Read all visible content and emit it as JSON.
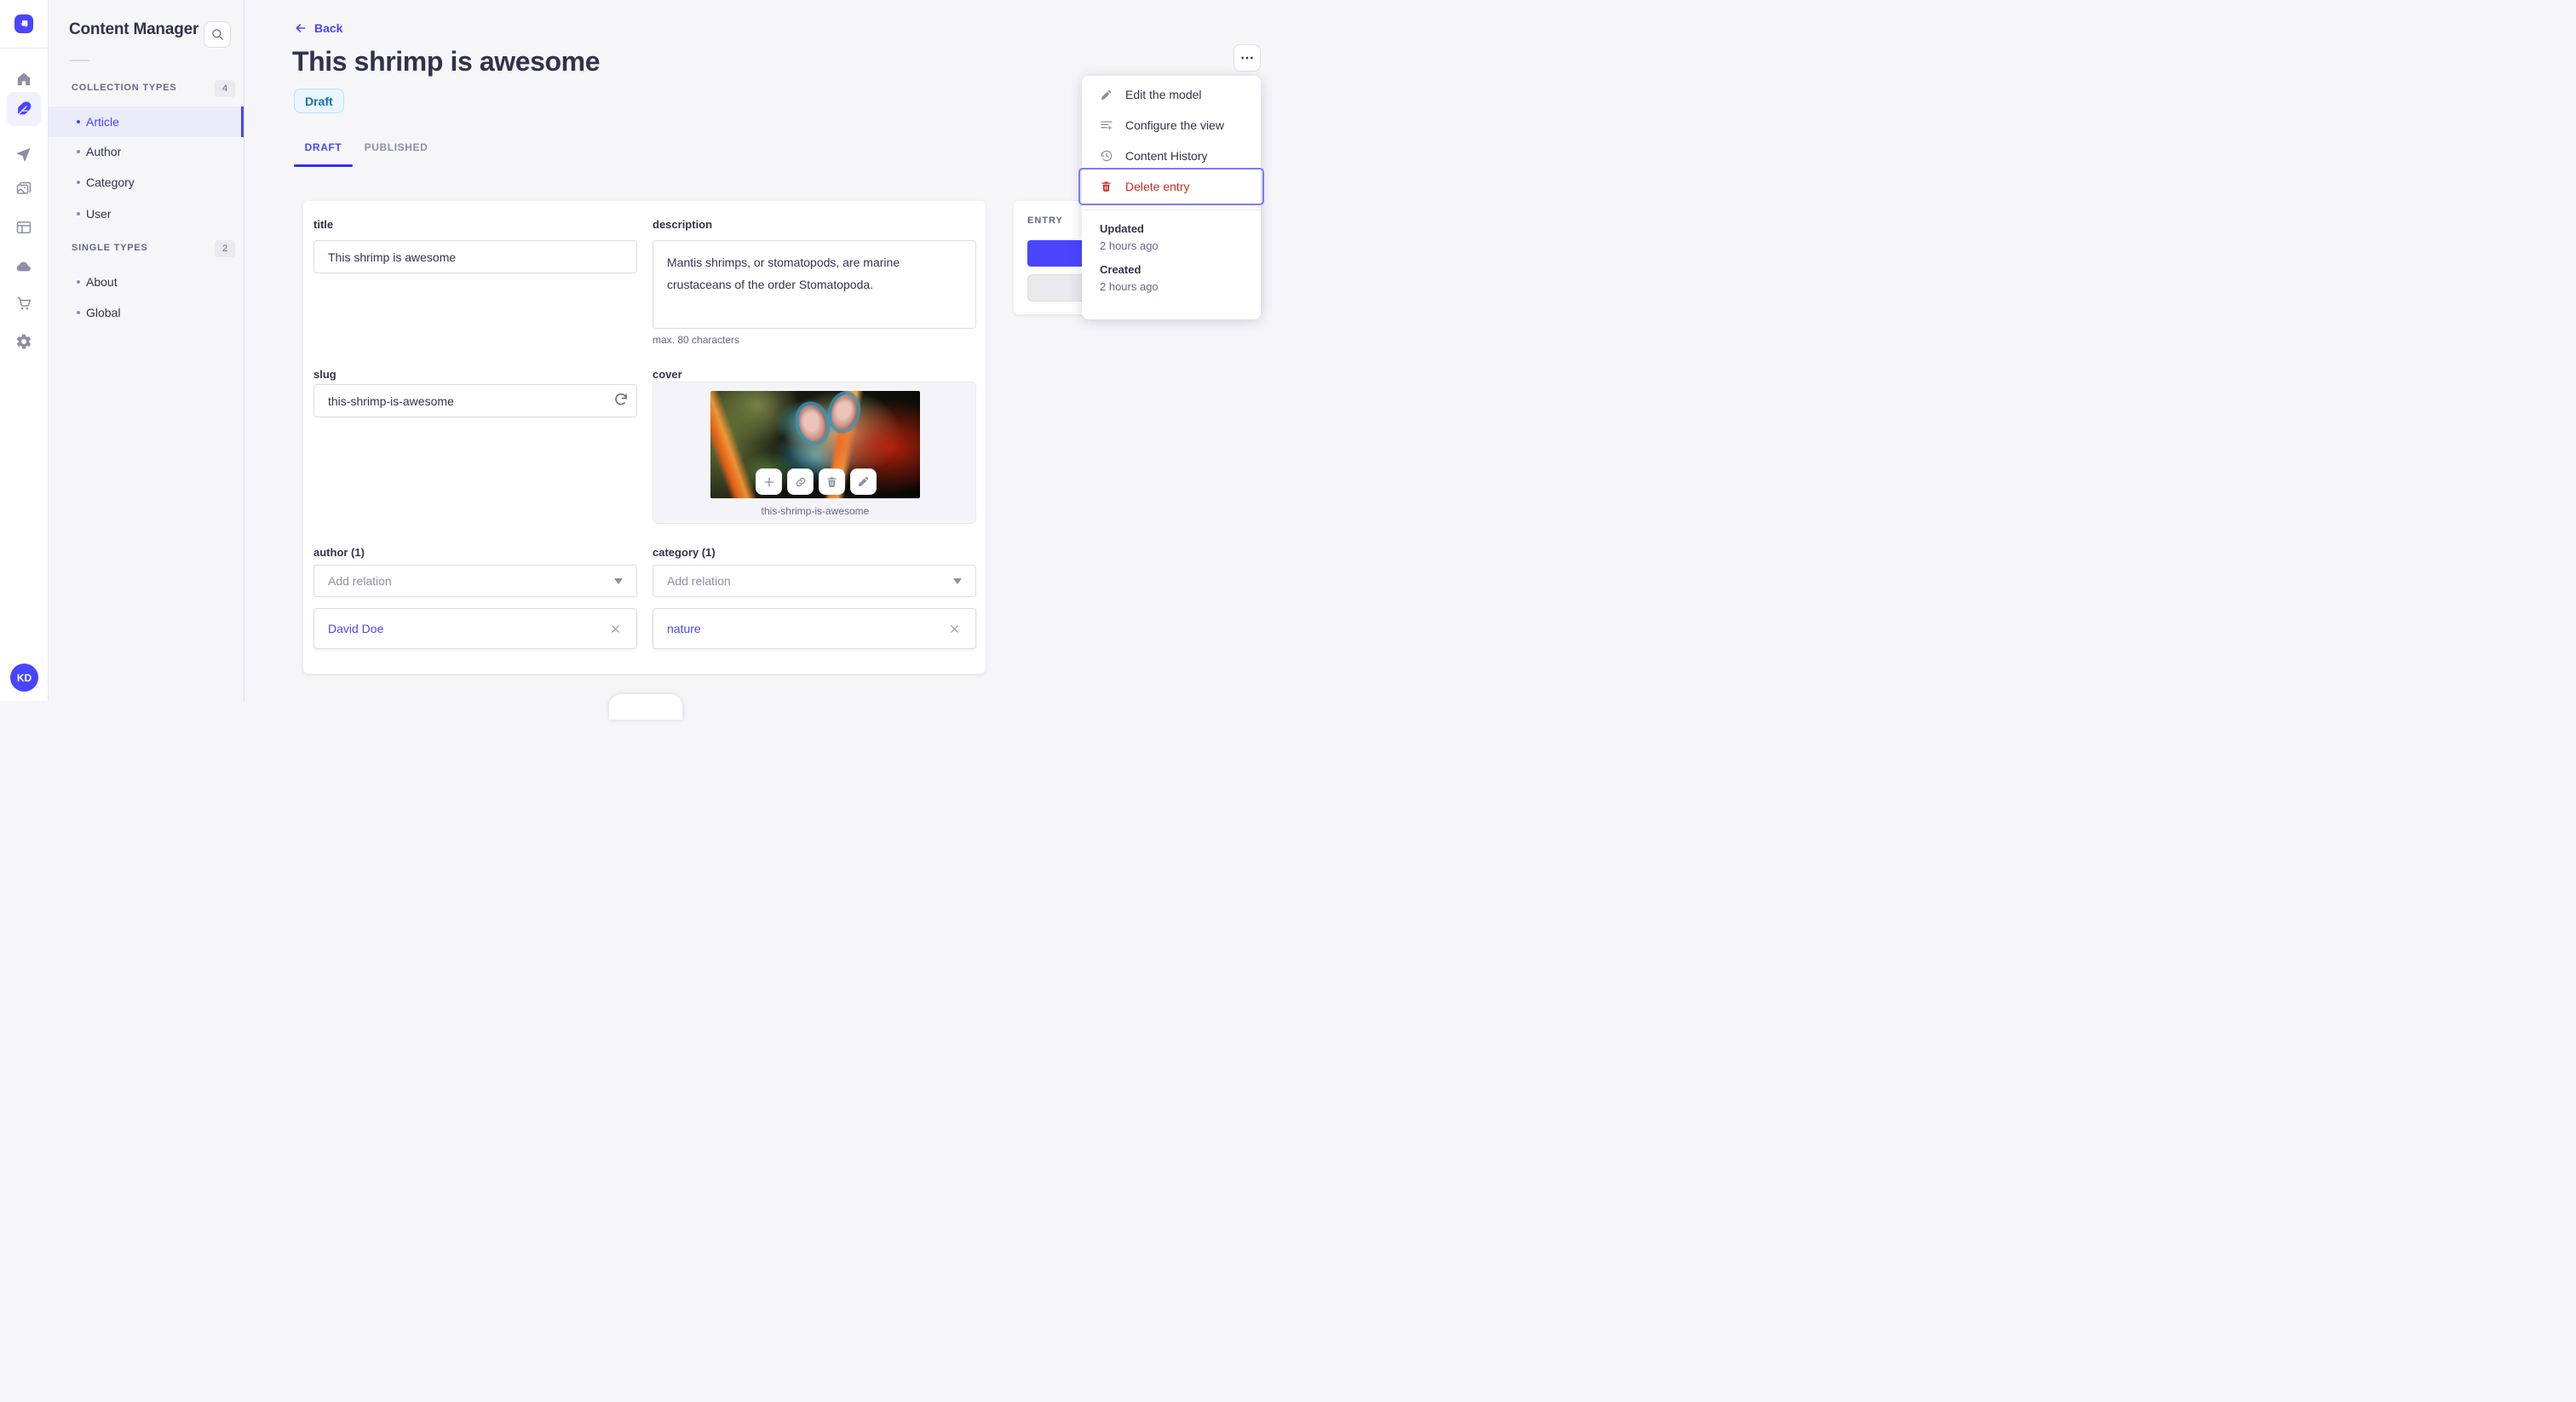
{
  "nav": {
    "logo": "strapi-logo",
    "avatar_initials": "KD"
  },
  "subnav": {
    "title": "Content Manager",
    "sections": [
      {
        "label": "COLLECTION TYPES",
        "count": "4",
        "items": [
          {
            "label": "Article"
          },
          {
            "label": "Author"
          },
          {
            "label": "Category"
          },
          {
            "label": "User"
          }
        ]
      },
      {
        "label": "SINGLE TYPES",
        "count": "2",
        "items": [
          {
            "label": "About"
          },
          {
            "label": "Global"
          }
        ]
      }
    ]
  },
  "header": {
    "back_label": "Back",
    "title": "This shrimp is awesome",
    "status_badge": "Draft",
    "more_label": "⋯"
  },
  "tabs": [
    {
      "label": "DRAFT"
    },
    {
      "label": "PUBLISHED"
    }
  ],
  "form": {
    "title_field": {
      "label": "title",
      "value": "This shrimp is awesome"
    },
    "description_field": {
      "label": "description",
      "value": "Mantis shrimps, or stomatopods, are marine crustaceans of the order Stomatopoda.",
      "hint": "max. 80 characters"
    },
    "slug_field": {
      "label": "slug",
      "value": "this-shrimp-is-awesome"
    },
    "cover_field": {
      "label": "cover",
      "caption": "this-shrimp-is-awesome"
    },
    "author_field": {
      "label": "author (1)",
      "placeholder": "Add relation",
      "relation": "David Doe"
    },
    "category_field": {
      "label": "category (1)",
      "placeholder": "Add relation",
      "relation": "nature"
    }
  },
  "entry_panel": {
    "title": "ENTRY"
  },
  "context_menu": {
    "items": [
      {
        "label": "Edit the model"
      },
      {
        "label": "Configure the view"
      },
      {
        "label": "Content History"
      },
      {
        "label": "Delete entry"
      }
    ],
    "meta": [
      {
        "label": "Updated",
        "value": "2 hours ago"
      },
      {
        "label": "Created",
        "value": "2 hours ago"
      }
    ]
  },
  "colors": {
    "primary": "#4945ff",
    "danger": "#d02b20",
    "active_item_bg": "#ebebfa",
    "draft_badge_bg": "#eaf5ff",
    "draft_badge_border": "#b8e1ff",
    "draft_badge_text": "#0c75af",
    "background": "#f6f6f9"
  }
}
